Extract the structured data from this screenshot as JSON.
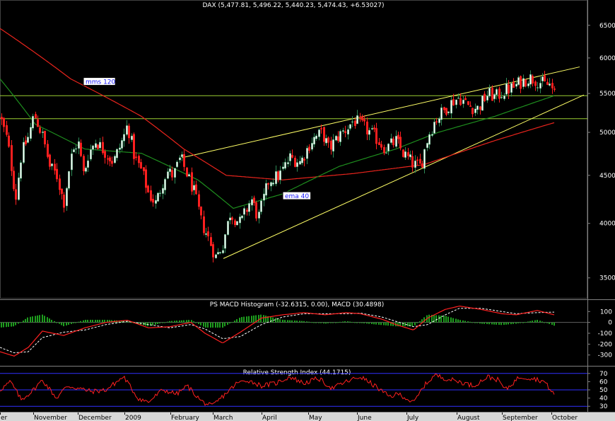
{
  "chart_data": [
    {
      "type": "candlestick",
      "title": "DAX (5,477.81, 5,496.22, 5,440.23, 5,474.43, +6.53027)",
      "y_ticks": [
        3500,
        4000,
        4500,
        5000,
        5500,
        6000,
        6500
      ],
      "ylim": [
        3350,
        6750
      ],
      "y_scale": "log",
      "x_labels": [
        "er",
        "November",
        "December",
        "2009",
        "February",
        "March",
        "April",
        "May",
        "June",
        "July",
        "August",
        "September",
        "October"
      ],
      "close_anchors": [
        [
          0,
          5200
        ],
        [
          10,
          4900
        ],
        [
          22,
          4250
        ],
        [
          30,
          4750
        ],
        [
          40,
          4950
        ],
        [
          48,
          5230
        ],
        [
          60,
          4950
        ],
        [
          70,
          4600
        ],
        [
          80,
          4500
        ],
        [
          90,
          4200
        ],
        [
          100,
          4700
        ],
        [
          110,
          4900
        ],
        [
          118,
          4500
        ],
        [
          125,
          4750
        ],
        [
          135,
          4900
        ],
        [
          150,
          4750
        ],
        [
          160,
          4650
        ],
        [
          175,
          4950
        ],
        [
          180,
          5100
        ],
        [
          190,
          4700
        ],
        [
          200,
          4550
        ],
        [
          210,
          4300
        ],
        [
          220,
          4200
        ],
        [
          235,
          4550
        ],
        [
          245,
          4500
        ],
        [
          255,
          4700
        ],
        [
          265,
          4500
        ],
        [
          275,
          4300
        ],
        [
          285,
          4000
        ],
        [
          295,
          3850
        ],
        [
          305,
          3680
        ],
        [
          315,
          3800
        ],
        [
          325,
          4100
        ],
        [
          340,
          4000
        ],
        [
          355,
          4250
        ],
        [
          365,
          4050
        ],
        [
          380,
          4450
        ],
        [
          395,
          4500
        ],
        [
          410,
          4700
        ],
        [
          425,
          4650
        ],
        [
          440,
          4900
        ],
        [
          455,
          5000
        ],
        [
          465,
          4800
        ],
        [
          478,
          4950
        ],
        [
          490,
          5050
        ],
        [
          500,
          5150
        ],
        [
          510,
          5100
        ],
        [
          520,
          5020
        ],
        [
          530,
          4950
        ],
        [
          545,
          4800
        ],
        [
          560,
          4900
        ],
        [
          570,
          4750
        ],
        [
          585,
          4620
        ],
        [
          595,
          4600
        ],
        [
          605,
          4950
        ],
        [
          615,
          5150
        ],
        [
          625,
          5250
        ],
        [
          640,
          5400
        ],
        [
          650,
          5450
        ],
        [
          660,
          5350
        ],
        [
          675,
          5300
        ],
        [
          690,
          5500
        ],
        [
          700,
          5450
        ],
        [
          715,
          5550
        ],
        [
          725,
          5580
        ],
        [
          735,
          5650
        ],
        [
          748,
          5720
        ],
        [
          760,
          5680
        ],
        [
          770,
          5620
        ],
        [
          778,
          5620
        ],
        [
          784,
          5480
        ]
      ],
      "series": [
        {
          "name": "mms 120",
          "color": "#e8241c",
          "values": [
            [
              0,
              6450
            ],
            [
              100,
              5700
            ],
            [
              200,
              5200
            ],
            [
              260,
              4800
            ],
            [
              320,
              4500
            ],
            [
              400,
              4450
            ],
            [
              500,
              4520
            ],
            [
              600,
              4620
            ],
            [
              700,
              4900
            ],
            [
              784,
              5120
            ]
          ]
        },
        {
          "name": "ema 40",
          "color": "#1e8e1e",
          "values": [
            [
              0,
              5700
            ],
            [
              50,
              5100
            ],
            [
              120,
              4800
            ],
            [
              200,
              4750
            ],
            [
              280,
              4450
            ],
            [
              330,
              4150
            ],
            [
              400,
              4300
            ],
            [
              480,
              4600
            ],
            [
              560,
              4800
            ],
            [
              620,
              5000
            ],
            [
              700,
              5200
            ],
            [
              784,
              5470
            ]
          ]
        }
      ],
      "trendlines": [
        {
          "from": [
            258,
            4700
          ],
          "to": [
            820,
            5870
          ]
        },
        {
          "from": [
            316,
            3670
          ],
          "to": [
            826,
            5480
          ]
        }
      ],
      "horizontal_lines": [
        5470,
        5170
      ],
      "annotations": [
        {
          "text": "mms 120",
          "x": 118,
          "y": 5650
        },
        {
          "text": "ema 40",
          "x": 400,
          "y": 4270
        }
      ]
    },
    {
      "type": "macd",
      "title": "PS MACD Histogram (-32.6315, 0.00), MACD (30.4898)",
      "y_ticks": [
        100,
        0,
        -100,
        -200,
        -300
      ],
      "ylim": [
        -380,
        180
      ],
      "macd_anchors": [
        [
          0,
          -270
        ],
        [
          20,
          -310
        ],
        [
          40,
          -230
        ],
        [
          60,
          -80
        ],
        [
          90,
          -120
        ],
        [
          120,
          -50
        ],
        [
          150,
          0
        ],
        [
          180,
          20
        ],
        [
          210,
          -50
        ],
        [
          240,
          -40
        ],
        [
          270,
          0
        ],
        [
          290,
          -100
        ],
        [
          315,
          -190
        ],
        [
          340,
          -90
        ],
        [
          370,
          40
        ],
        [
          400,
          70
        ],
        [
          430,
          90
        ],
        [
          460,
          70
        ],
        [
          490,
          90
        ],
        [
          510,
          80
        ],
        [
          540,
          30
        ],
        [
          560,
          -20
        ],
        [
          585,
          -70
        ],
        [
          605,
          40
        ],
        [
          630,
          120
        ],
        [
          650,
          150
        ],
        [
          680,
          120
        ],
        [
          710,
          80
        ],
        [
          730,
          70
        ],
        [
          760,
          110
        ],
        [
          784,
          70
        ]
      ],
      "signal_anchors": [
        [
          0,
          -230
        ],
        [
          20,
          -280
        ],
        [
          40,
          -270
        ],
        [
          60,
          -140
        ],
        [
          90,
          -90
        ],
        [
          120,
          -70
        ],
        [
          150,
          -20
        ],
        [
          180,
          10
        ],
        [
          210,
          -20
        ],
        [
          240,
          -50
        ],
        [
          270,
          -20
        ],
        [
          290,
          -60
        ],
        [
          315,
          -150
        ],
        [
          340,
          -130
        ],
        [
          370,
          -20
        ],
        [
          400,
          50
        ],
        [
          430,
          80
        ],
        [
          460,
          80
        ],
        [
          490,
          80
        ],
        [
          510,
          85
        ],
        [
          540,
          50
        ],
        [
          560,
          10
        ],
        [
          585,
          -40
        ],
        [
          605,
          -20
        ],
        [
          630,
          70
        ],
        [
          650,
          130
        ],
        [
          680,
          130
        ],
        [
          710,
          100
        ],
        [
          730,
          80
        ],
        [
          760,
          90
        ],
        [
          784,
          95
        ]
      ]
    },
    {
      "type": "rsi",
      "title": "Relative Strength Index (44.1715)",
      "y_ticks": [
        70,
        60,
        50,
        40,
        30
      ],
      "ylim": [
        25,
        75
      ],
      "levels": [
        70,
        50,
        30
      ],
      "rsi_anchors": [
        [
          0,
          50
        ],
        [
          15,
          60
        ],
        [
          30,
          38
        ],
        [
          45,
          48
        ],
        [
          60,
          62
        ],
        [
          80,
          40
        ],
        [
          95,
          55
        ],
        [
          110,
          52
        ],
        [
          130,
          48
        ],
        [
          150,
          50
        ],
        [
          175,
          66
        ],
        [
          195,
          40
        ],
        [
          210,
          35
        ],
        [
          230,
          50
        ],
        [
          250,
          45
        ],
        [
          265,
          55
        ],
        [
          285,
          36
        ],
        [
          300,
          30
        ],
        [
          315,
          42
        ],
        [
          335,
          58
        ],
        [
          350,
          62
        ],
        [
          370,
          55
        ],
        [
          390,
          58
        ],
        [
          410,
          66
        ],
        [
          430,
          58
        ],
        [
          450,
          64
        ],
        [
          470,
          52
        ],
        [
          490,
          60
        ],
        [
          510,
          66
        ],
        [
          530,
          55
        ],
        [
          550,
          42
        ],
        [
          565,
          45
        ],
        [
          585,
          34
        ],
        [
          600,
          55
        ],
        [
          615,
          68
        ],
        [
          630,
          64
        ],
        [
          650,
          60
        ],
        [
          670,
          55
        ],
        [
          690,
          66
        ],
        [
          705,
          62
        ],
        [
          715,
          50
        ],
        [
          735,
          66
        ],
        [
          755,
          64
        ],
        [
          770,
          60
        ],
        [
          784,
          44
        ]
      ]
    }
  ]
}
